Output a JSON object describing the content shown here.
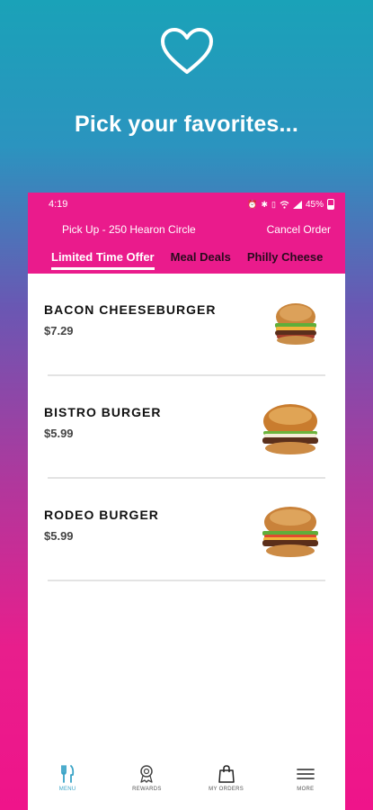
{
  "promo": {
    "tagline": "Pick your favorites...",
    "icon": "heart-outline-icon",
    "colors": {
      "gradient_top": "#1aa2b8",
      "gradient_bottom": "#ef148a"
    }
  },
  "status_bar": {
    "time": "4:19",
    "battery": "45%",
    "icons": [
      "alarm-icon",
      "bluetooth-icon",
      "vibrate-icon",
      "wifi-icon",
      "signal-icon",
      "battery-icon"
    ]
  },
  "header": {
    "location": "Pick Up - 250 Hearon Circle",
    "cancel_label": "Cancel Order",
    "brand_color": "#ea1b8c"
  },
  "tabs": [
    {
      "label": "Limited Time Offer",
      "active": true
    },
    {
      "label": "Meal Deals",
      "active": false
    },
    {
      "label": "Philly Cheese",
      "active": false
    }
  ],
  "menu_items": [
    {
      "name": "BACON CHEESEBURGER",
      "price": "$7.29"
    },
    {
      "name": "BISTRO BURGER",
      "price": "$5.99"
    },
    {
      "name": "RODEO BURGER",
      "price": "$5.99"
    }
  ],
  "bottom_nav": [
    {
      "label": "MENU",
      "icon": "fork-knife-icon",
      "active": true
    },
    {
      "label": "REWARDS",
      "icon": "award-ribbon-icon",
      "active": false
    },
    {
      "label": "MY ORDERS",
      "icon": "shopping-bag-icon",
      "active": false
    },
    {
      "label": "MORE",
      "icon": "hamburger-menu-icon",
      "active": false
    }
  ],
  "accent_color": "#39a3c6"
}
